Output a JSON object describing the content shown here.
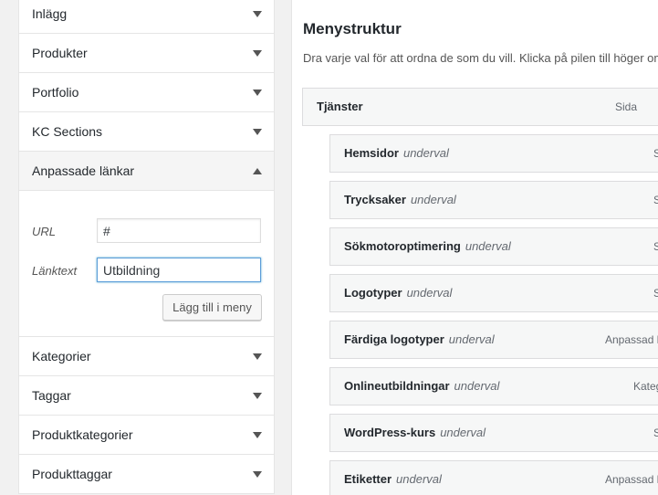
{
  "left_panel": {
    "sections_top": [
      {
        "label": "Inlägg"
      },
      {
        "label": "Produkter"
      },
      {
        "label": "Portfolio"
      },
      {
        "label": "KC Sections"
      }
    ],
    "custom_links": {
      "label": "Anpassade länkar",
      "url_label": "URL",
      "url_value": "#",
      "link_text_label": "Länktext",
      "link_text_value": "Utbildning",
      "add_button": "Lägg till i meny"
    },
    "sections_bottom": [
      {
        "label": "Kategorier"
      },
      {
        "label": "Taggar"
      },
      {
        "label": "Produktkategorier"
      },
      {
        "label": "Produkttaggar"
      }
    ]
  },
  "menu_structure": {
    "title": "Menystruktur",
    "description": "Dra varje val för att ordna de som du vill. Klicka på pilen till höger om",
    "top_item": {
      "title": "Tjänster",
      "type": "Sida"
    },
    "sub_items": [
      {
        "title": "Hemsidor",
        "sub_label": "underval",
        "type": "S"
      },
      {
        "title": "Trycksaker",
        "sub_label": "underval",
        "type": "S"
      },
      {
        "title": "Sökmotoroptimering",
        "sub_label": "underval",
        "type": "S"
      },
      {
        "title": "Logotyper",
        "sub_label": "underval",
        "type": "S"
      },
      {
        "title": "Färdiga logotyper",
        "sub_label": "underval",
        "type": "Anpassad l"
      },
      {
        "title": "Onlineutbildningar",
        "sub_label": "underval",
        "type": "Kateg"
      },
      {
        "title": "WordPress-kurs",
        "sub_label": "underval",
        "type": "S"
      },
      {
        "title": "Etiketter",
        "sub_label": "underval",
        "type": "Anpassad l"
      }
    ]
  }
}
